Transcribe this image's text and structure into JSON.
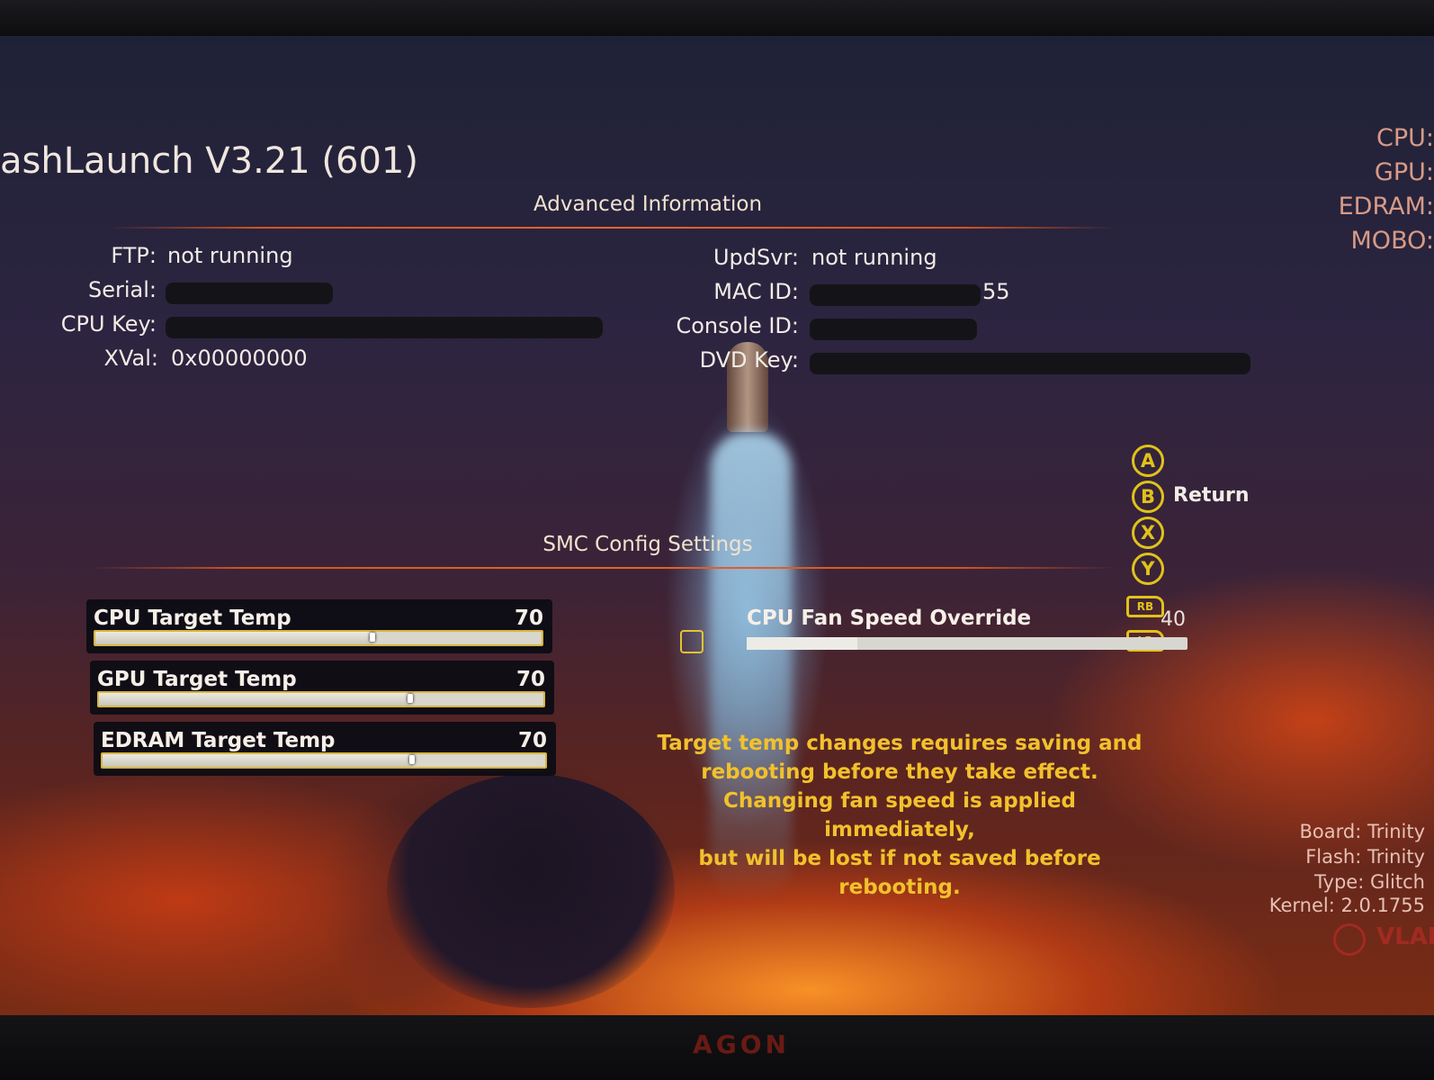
{
  "app": {
    "title": "ashLaunch V3.21 (601)"
  },
  "advanced": {
    "heading": "Advanced Information",
    "left": [
      {
        "label": "FTP:",
        "value": "not running"
      },
      {
        "label": "Serial:",
        "value": ""
      },
      {
        "label": "CPU Key:",
        "value": ""
      },
      {
        "label": "XVal:",
        "value": "0x00000000"
      }
    ],
    "right": [
      {
        "label": "UpdSvr:",
        "value": "not running"
      },
      {
        "label": "MAC ID:",
        "value": "55"
      },
      {
        "label": "Console ID:",
        "value": ""
      },
      {
        "label": "DVD Key:",
        "value": ""
      }
    ]
  },
  "temps_sidebar": {
    "cpu": "CPU:",
    "gpu": "GPU:",
    "edram": "EDRAM:",
    "mobo": "MOBO:"
  },
  "buttons": {
    "a": "A",
    "b": "B",
    "x": "X",
    "y": "Y",
    "b_label": "Return",
    "rb": "RB",
    "lb": "LB"
  },
  "smc": {
    "heading": "SMC Config Settings",
    "sliders": [
      {
        "label": "CPU Target Temp",
        "value": "70",
        "level": 0.62
      },
      {
        "label": "GPU Target Temp",
        "value": "70",
        "level": 0.7
      },
      {
        "label": "EDRAM Target Temp",
        "value": "70",
        "level": 0.7
      }
    ],
    "fan": {
      "label": "CPU Fan Speed Override",
      "value": "40",
      "level": 0.25,
      "checked": false
    }
  },
  "notice": {
    "line1": "Target temp changes requires saving and",
    "line2": "rebooting before they take effect.",
    "line3": "Changing fan speed is applied immediately,",
    "line4": "but will be lost if not saved before rebooting."
  },
  "system": {
    "board": "Board: Trinity",
    "flash": "Flash: Trinity",
    "type": "Type: Glitch",
    "kernel": "Kernel: 2.0.1755"
  },
  "logo_text": "VLAD",
  "monitor_brand": "AGON"
}
